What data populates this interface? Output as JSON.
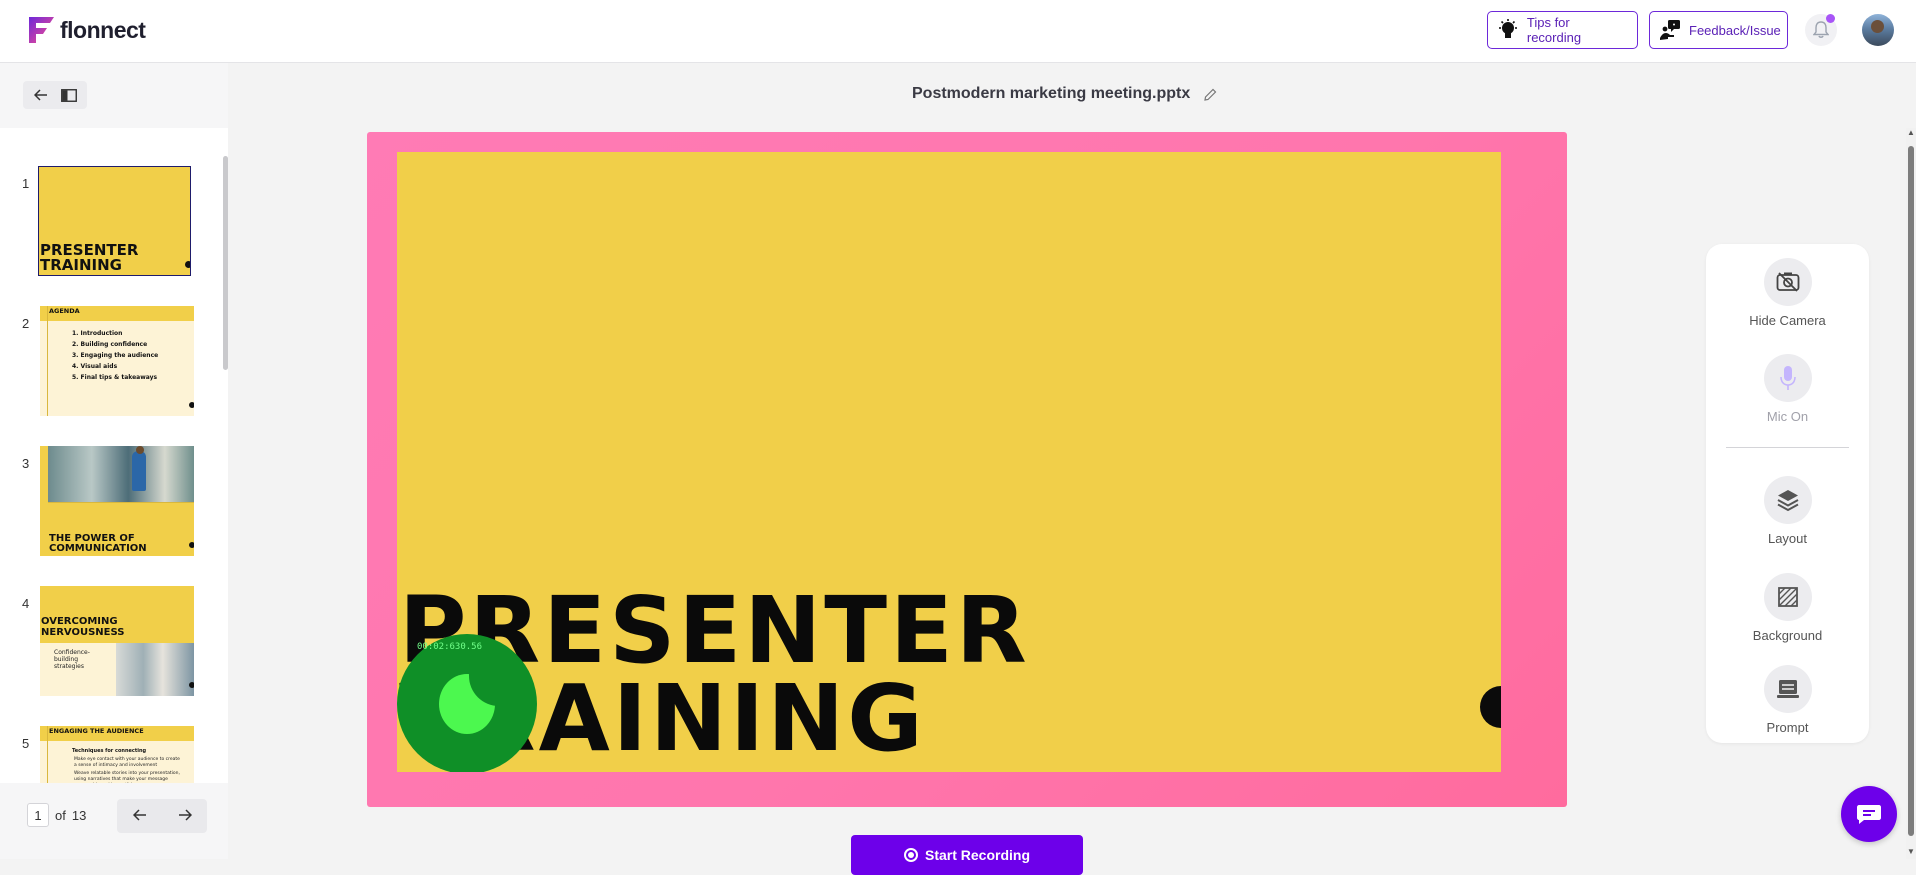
{
  "app": {
    "brand": "flonnect",
    "brand_color": "#6d00ea"
  },
  "header": {
    "tips_label": "Tips for recording",
    "feedback_label": "Feedback/Issue"
  },
  "file": {
    "name": "Postmodern marketing meeting.pptx"
  },
  "thumbnails": [
    {
      "num": "1",
      "title": "PRESENTER TRAINING"
    },
    {
      "num": "2",
      "title": "AGENDA",
      "items": [
        "1. Introduction",
        "2. Building confidence",
        "3. Engaging the audience",
        "4. Visual aids",
        "5. Final tips & takeaways"
      ]
    },
    {
      "num": "3",
      "title": "THE POWER OF COMMUNICATION"
    },
    {
      "num": "4",
      "title": "OVERCOMING NERVOUSNESS",
      "subtitle": "Confidence-building strategies"
    },
    {
      "num": "5",
      "title": "ENGAGING THE AUDIENCE",
      "subtitle": "Techniques for connecting",
      "bullets": [
        "Make eye contact with your audience to create a sense of intimacy and involvement",
        "Weave relatable stories into your presentation, using narratives that make your message memorable and impactful"
      ]
    }
  ],
  "pager": {
    "current": "1",
    "of_label": "of",
    "total": "13"
  },
  "slide": {
    "title_line1": "PRESENTER",
    "title_line2": "TRAINING",
    "bg_color": "#f1cf49",
    "frame_color": "#ff78ae"
  },
  "camera": {
    "timer": "00:02:630.56"
  },
  "start_recording_label": "Start Recording",
  "right_panel": {
    "hide_camera": "Hide Camera",
    "mic_on": "Mic On",
    "layout": "Layout",
    "background": "Background",
    "prompt": "Prompt"
  }
}
